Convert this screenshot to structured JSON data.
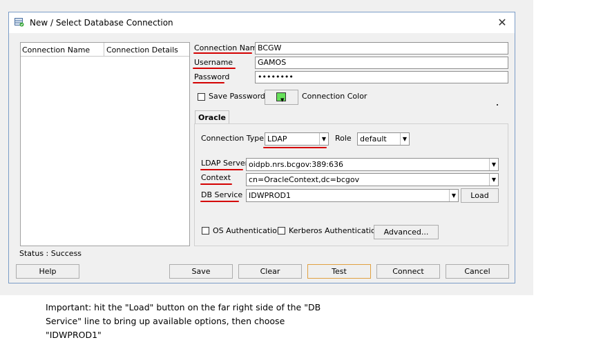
{
  "window": {
    "title": "New / Select Database Connection",
    "close_glyph": "✕"
  },
  "list": {
    "columns": [
      "Connection Name",
      "Connection Details"
    ]
  },
  "status": "Status : Success",
  "form": {
    "connection_name_label": "Connection Name",
    "connection_name_value": "BCGW",
    "username_label": "Username",
    "username_value": "GAMOS",
    "password_label": "Password",
    "password_value": "••••••••",
    "save_password_label": "Save Password",
    "connection_color_label": "Connection Color",
    "connection_color": "#66e05a"
  },
  "tabs": [
    {
      "label": "Oracle"
    }
  ],
  "oracle": {
    "connection_type_label": "Connection Type",
    "connection_type_value": "LDAP",
    "role_label": "Role",
    "role_value": "default",
    "ldap_server_label": "LDAP Server",
    "ldap_server_value": "oidpb.nrs.bcgov:389:636",
    "context_label": "Context",
    "context_value": "cn=OracleContext,dc=bcgov",
    "db_service_label": "DB Service",
    "db_service_value": "IDWPROD1",
    "load_label": "Load",
    "os_auth_label": "OS Authentication",
    "kerberos_auth_label": "Kerberos Authentication",
    "advanced_label": "Advanced..."
  },
  "buttons": {
    "help": "Help",
    "save": "Save",
    "clear": "Clear",
    "test": "Test",
    "connect": "Connect",
    "cancel": "Cancel"
  },
  "annotation": {
    "note": "Important: hit the \"Load\" button on the far right side of the \"DB Service\" line to bring up available options, then choose \"IDWPROD1\"",
    "underline_color": "#d40000"
  },
  "icons": {
    "dropdown_arrow": "▼"
  }
}
